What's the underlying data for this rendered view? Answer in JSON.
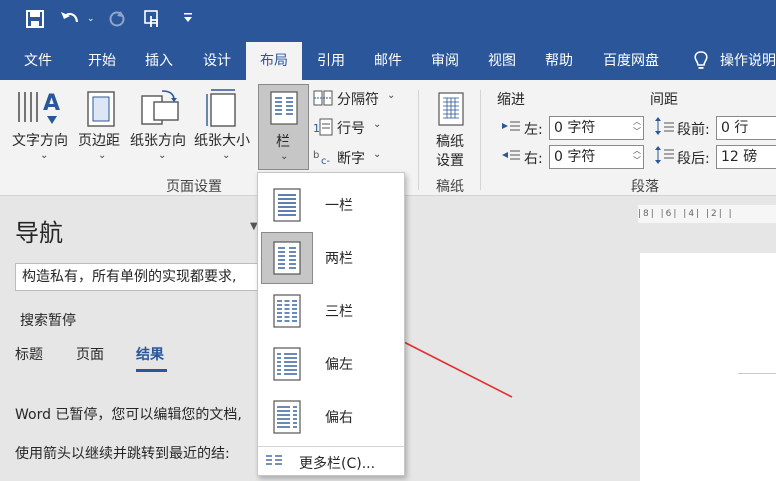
{
  "quick_access": {
    "save_icon": "save-icon",
    "undo_icon": "undo-icon",
    "redo_icon": "redo-icon",
    "touch_icon": "touch-mode-icon",
    "customize_icon": "customize-icon"
  },
  "tabs": [
    "文件",
    "开始",
    "插入",
    "设计",
    "布局",
    "引用",
    "邮件",
    "审阅",
    "视图",
    "帮助",
    "百度网盘",
    "操作说明"
  ],
  "active_tab": "布局",
  "ribbon": {
    "page_setup": {
      "text_direction": "文字方向",
      "margins": "页边距",
      "orientation": "纸张方向",
      "size": "纸张大小",
      "columns": "栏",
      "breaks": "分隔符",
      "line_numbers": "行号",
      "hyphenation": "断字",
      "group_label": "页面设置"
    },
    "manuscript": {
      "button_line1": "稿纸",
      "button_line2": "设置",
      "group_label": "稿纸"
    },
    "paragraph": {
      "indent_label": "缩进",
      "spacing_label": "间距",
      "left_label": "左:",
      "right_label": "右:",
      "before_label": "段前:",
      "after_label": "段后:",
      "left_value": "0 字符",
      "right_value": "0 字符",
      "before_value": "0 行",
      "after_value": "12 磅",
      "group_label": "段落"
    }
  },
  "nav": {
    "title": "导航",
    "search_value": "构造私有，所有单例的实现都要求,",
    "status": "搜索暂停",
    "tabs": [
      "标题",
      "页面",
      "结果"
    ],
    "active_tab": "结果",
    "message1": "Word 已暂停，您可以编辑您的文档,",
    "message2": "使用箭头以继续并跳转到最近的结:"
  },
  "ruler": {
    "marks": "|8|  |6|  |4|  |2|  |"
  },
  "columns_menu": {
    "items": [
      "一栏",
      "两栏",
      "三栏",
      "偏左",
      "偏右"
    ],
    "selected": "两栏",
    "more": "更多栏(C)..."
  },
  "colors": {
    "brand": "#2b579a",
    "ribbon_bg": "#f3f3f3",
    "pane_bg": "#e6e6e6",
    "accent_underline": "#2b579a",
    "annotation_arrow": "#e03030"
  }
}
